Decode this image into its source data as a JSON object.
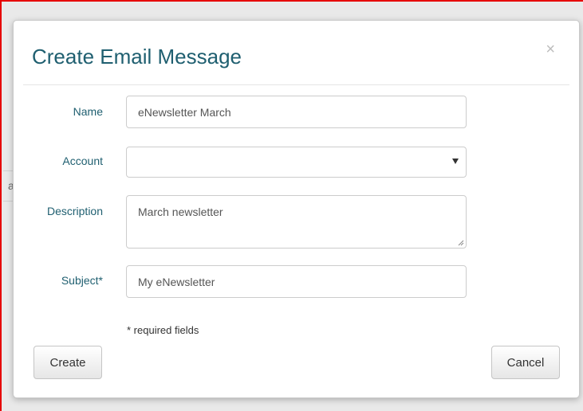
{
  "background": {
    "partial_text": "a"
  },
  "modal": {
    "title": "Create Email Message",
    "close_glyph": "×",
    "close_icon": "close-icon"
  },
  "form": {
    "name": {
      "label": "Name",
      "value": "eNewsletter March"
    },
    "account": {
      "label": "Account",
      "value": ""
    },
    "description": {
      "label": "Description",
      "value": "March newsletter"
    },
    "subject": {
      "label": "Subject*",
      "value": "My eNewsletter"
    },
    "required_note": "* required fields"
  },
  "buttons": {
    "create_label": "Create",
    "cancel_label": "Cancel"
  },
  "colors": {
    "title": "#1f5f70",
    "label": "#1f5f70",
    "frame_border": "#e60000"
  }
}
